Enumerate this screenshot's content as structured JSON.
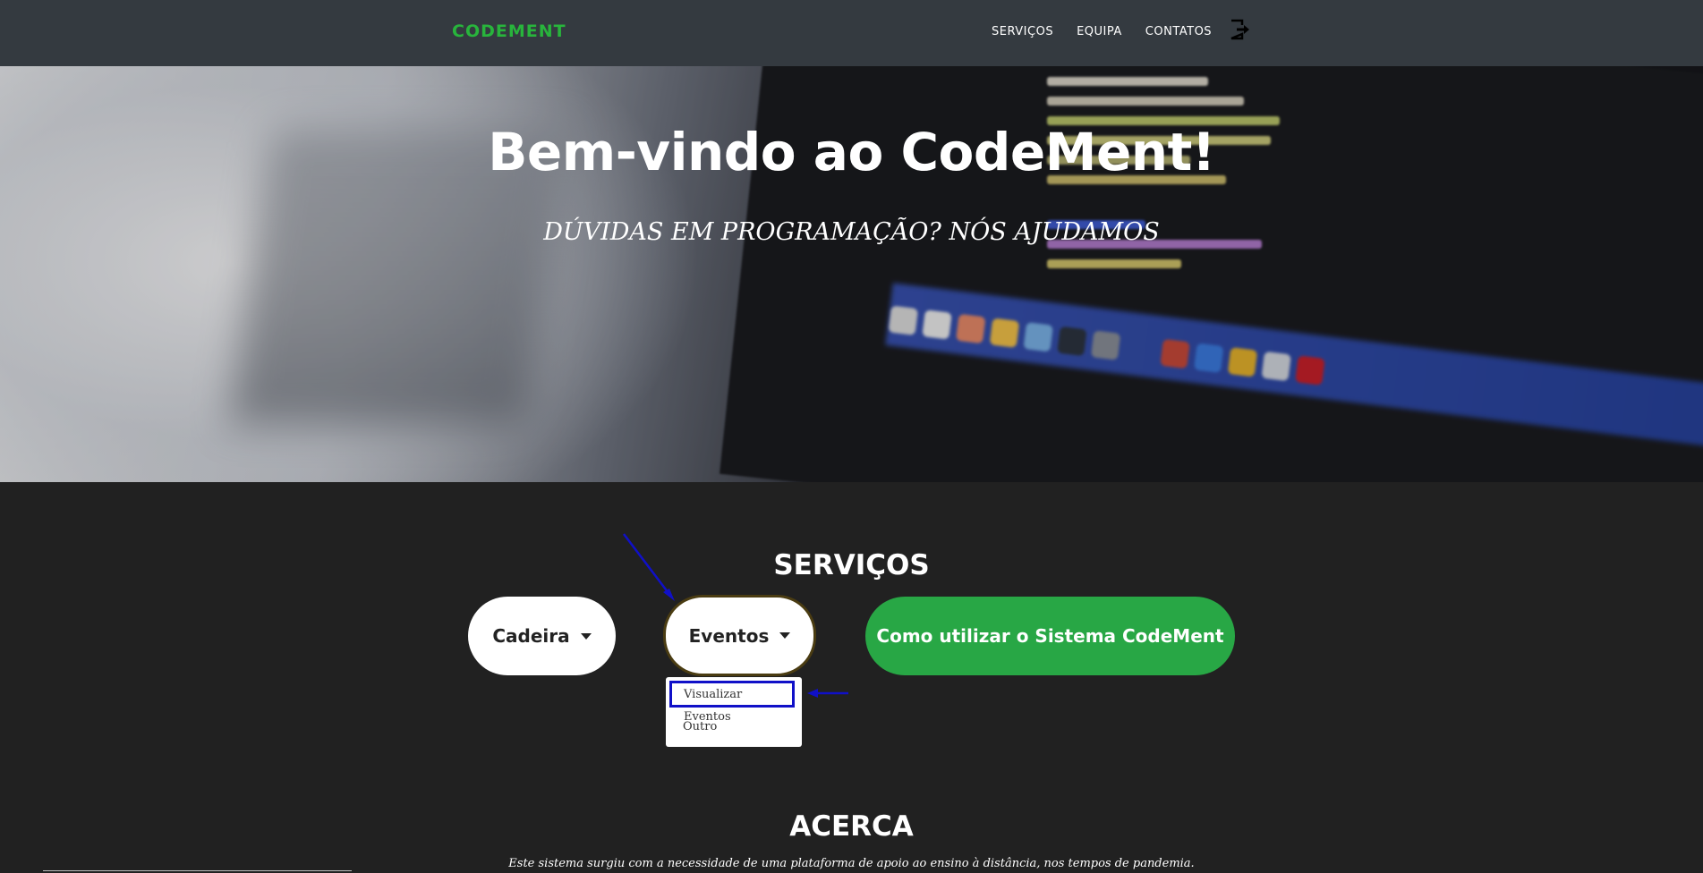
{
  "navbar": {
    "brand": "CODEMENT",
    "links": [
      "SERVIÇOS",
      "EQUIPA",
      "CONTATOS"
    ],
    "logout_icon": "sign-out-icon"
  },
  "hero": {
    "title": "Bem-vindo ao CodeMent!",
    "subtitle": "DÚVIDAS EM PROGRAMAÇÃO? NÓS AJUDAMOS"
  },
  "services": {
    "title": "SERVIÇOS",
    "buttons": {
      "cadeira": "Cadeira",
      "eventos": "Eventos",
      "guide": "Como utilizar o Sistema CodeMent"
    },
    "dropdown": {
      "items": [
        "Visualizar Eventos",
        "Outro"
      ],
      "highlighted": "Visualizar Eventos"
    }
  },
  "about": {
    "title": "ACERCA",
    "text": "Este sistema surgiu com a necessidade de uma plataforma de apoio ao ensino à distância, nos tempos de pandemia."
  },
  "colors": {
    "navbar": "#343a40",
    "brand": "#28b43c",
    "page_bg": "#212121",
    "guide_button": "#28a745",
    "annotation": "#1010c8"
  }
}
